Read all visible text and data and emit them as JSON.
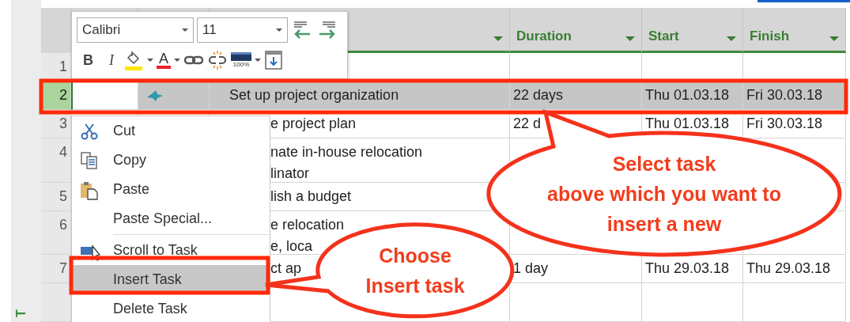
{
  "view_bar": {
    "label": "T"
  },
  "table": {
    "columns": [
      "Duration",
      "Start",
      "Finish"
    ],
    "rows": [
      {
        "number": "1",
        "selected": false
      },
      {
        "number": "2",
        "selected": true,
        "covered_left": false,
        "name": "Set up project organization",
        "duration": "22 days",
        "start": "Thu 01.03.18",
        "finish": "Fri 30.03.18"
      },
      {
        "number": "3",
        "selected": false,
        "covered_left": true,
        "name": "e project plan",
        "duration": "22 d",
        "start": "Thu 01.03.18",
        "finish": "Fri 30.03.18"
      },
      {
        "number": "4",
        "selected": false,
        "covered_left": true,
        "name": "nate in-house relocation\nlinator"
      },
      {
        "number": "5",
        "selected": false,
        "covered_left": true,
        "name": "lish a budget"
      },
      {
        "number": "6",
        "selected": false,
        "covered_left": true,
        "name": "e relocation\ne, loca"
      },
      {
        "number": "7",
        "selected": false,
        "covered_left": true,
        "name": "ct ap",
        "duration": "1 day",
        "start": "Thu 29.03.18",
        "finish": "Thu 29.03.18"
      }
    ]
  },
  "mini_toolbar": {
    "font": "Calibri",
    "size": "11",
    "bold": "B",
    "italic": "I",
    "font_color": "A",
    "progress_label": "100%"
  },
  "context_menu": [
    {
      "kind": "scissors",
      "label": "Cut",
      "selected": false
    },
    {
      "kind": "copy",
      "label": "Copy",
      "selected": false
    },
    {
      "kind": "paste",
      "label": "Paste",
      "selected": false
    },
    {
      "kind": "plain",
      "label": "Paste Special...",
      "selected": false
    },
    {
      "kind": "separator"
    },
    {
      "kind": "scroll",
      "label": "Scroll to Task",
      "selected": false
    },
    {
      "kind": "plain",
      "label": "Insert Task",
      "selected": true
    },
    {
      "kind": "plain",
      "label": "Delete Task",
      "selected": false
    }
  ],
  "callouts": [
    {
      "text": "Select task\nabove which you want to\ninsert a new"
    },
    {
      "text": "Choose\nInsert task"
    }
  ]
}
